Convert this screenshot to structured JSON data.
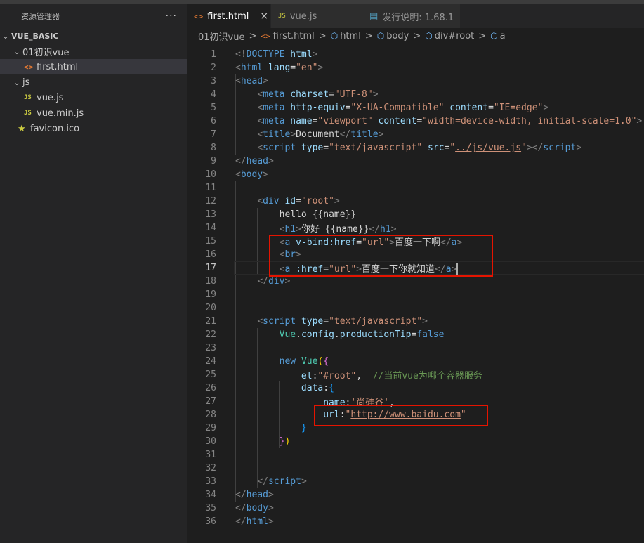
{
  "sidebar": {
    "title": "资源管理器",
    "more": "···",
    "root": "VUE_BASIC",
    "items": [
      {
        "label": "01初识vue"
      },
      {
        "label": "first.html"
      },
      {
        "label": "js"
      },
      {
        "label": "vue.js"
      },
      {
        "label": "vue.min.js"
      },
      {
        "label": "favicon.ico"
      }
    ],
    "js_badge": "JS",
    "html_badge": "<>"
  },
  "tabs": [
    {
      "label": "first.html",
      "close": "×"
    },
    {
      "label": "vue.js"
    },
    {
      "label": "发行说明: 1.68.1"
    }
  ],
  "breadcrumb": [
    "01初识vue",
    "first.html",
    "html",
    "body",
    "div#root",
    "a"
  ],
  "breadcrumb_sep": ">",
  "code": {
    "l1": [
      "<!",
      "DOCTYPE",
      " ",
      "html",
      ">"
    ],
    "l2": [
      "<",
      "html",
      " ",
      "lang",
      "=",
      "\"en\"",
      ">"
    ],
    "l3": [
      "<",
      "head",
      ">"
    ],
    "l4": [
      "<",
      "meta",
      " ",
      "charset",
      "=",
      "\"UTF-8\"",
      ">"
    ],
    "l5": [
      "<",
      "meta",
      " ",
      "http-equiv",
      "=",
      "\"X-UA-Compatible\"",
      " ",
      "content",
      "=",
      "\"IE=edge\"",
      ">"
    ],
    "l6": [
      "<",
      "meta",
      " ",
      "name",
      "=",
      "\"viewport\"",
      " ",
      "content",
      "=",
      "\"width=device-width, initial-scale=1.0\"",
      ">"
    ],
    "l7": [
      "<",
      "title",
      ">",
      "Document",
      "</",
      "title",
      ">"
    ],
    "l8": [
      "<",
      "script",
      " ",
      "type",
      "=",
      "\"text/javascript\"",
      " ",
      "src",
      "=",
      "\"",
      "../js/vue.js",
      "\"",
      "></",
      "script",
      ">"
    ],
    "l9": [
      "</",
      "head",
      ">"
    ],
    "l10": [
      "<",
      "body",
      ">"
    ],
    "l12": [
      "<",
      "div",
      " ",
      "id",
      "=",
      "\"root\"",
      ">"
    ],
    "l13": "hello {{name}}",
    "l14": [
      "<",
      "h1",
      ">",
      "你好 {{name}}",
      "</",
      "h1",
      ">"
    ],
    "l15": [
      "<",
      "a",
      " ",
      "v-bind:href",
      "=",
      "\"url\"",
      ">",
      "百度一下啊",
      "</",
      "a",
      ">"
    ],
    "l16": [
      "<",
      "br",
      ">"
    ],
    "l17": [
      "<",
      "a",
      " ",
      ":href",
      "=",
      "\"url\"",
      ">",
      "百度一下你就知道",
      "</",
      "a",
      ">"
    ],
    "l18": [
      "</",
      "div",
      ">"
    ],
    "l21": [
      "<",
      "script",
      " ",
      "type",
      "=",
      "\"text/javascript\"",
      ">"
    ],
    "l22": [
      "Vue",
      ".",
      "config",
      ".",
      "productionTip",
      "=",
      "false"
    ],
    "l24": [
      "new",
      " ",
      "Vue",
      "(",
      "{"
    ],
    "l25": [
      "el",
      ":",
      "\"#root\"",
      ",  ",
      "//当前vue为哪个容器服务"
    ],
    "l26": [
      "data",
      ":",
      "{"
    ],
    "l27": [
      "name",
      ":",
      "'尚硅谷'",
      ","
    ],
    "l28": [
      "url",
      ":",
      "\"",
      "http://www.baidu.com",
      "\""
    ],
    "l29": "}",
    "l30": [
      "}",
      ")"
    ],
    "l33": [
      "</",
      "script",
      ">"
    ],
    "l34": [
      "</",
      "head",
      ">"
    ],
    "l35": [
      "</",
      "body",
      ">"
    ],
    "l36": [
      "</",
      "html",
      ">"
    ]
  },
  "line_numbers": [
    "1",
    "2",
    "3",
    "4",
    "5",
    "6",
    "7",
    "8",
    "9",
    "10",
    "11",
    "12",
    "13",
    "14",
    "15",
    "16",
    "17",
    "18",
    "19",
    "20",
    "21",
    "22",
    "23",
    "24",
    "25",
    "26",
    "27",
    "28",
    "29",
    "30",
    "31",
    "32",
    "33",
    "34",
    "35",
    "36"
  ],
  "current_line": 17,
  "colors": {
    "annotation_box": "#e51400",
    "accent": "#007acc"
  }
}
